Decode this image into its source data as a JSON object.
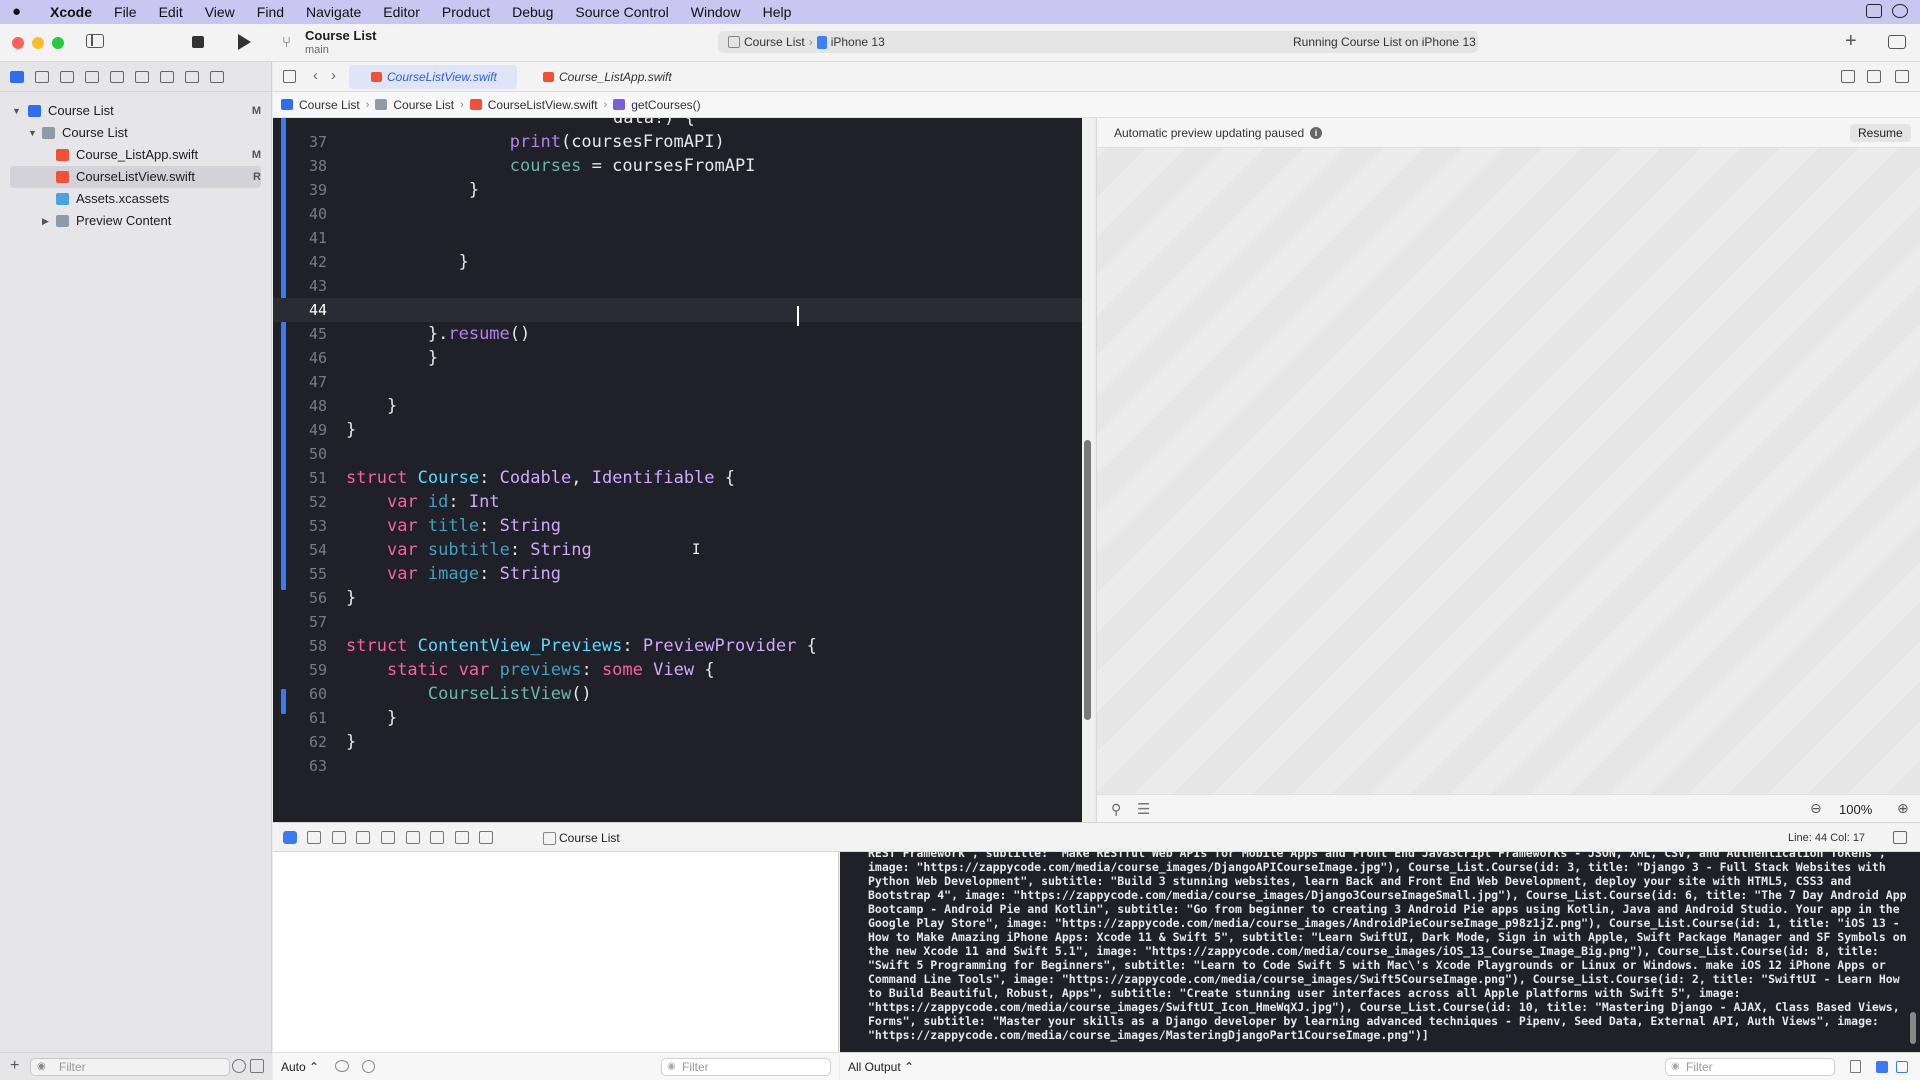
{
  "menubar": {
    "app": "Xcode",
    "items": [
      "File",
      "Edit",
      "View",
      "Find",
      "Navigate",
      "Editor",
      "Product",
      "Debug",
      "Source Control",
      "Window",
      "Help"
    ]
  },
  "toolbar": {
    "project_title": "Course List",
    "branch": "main",
    "scheme": "Course List",
    "device": "iPhone 13",
    "status": "Running Course List on iPhone 13"
  },
  "navigator": {
    "items": [
      {
        "label": "Course List",
        "badge": "M"
      },
      {
        "label": "Course List",
        "badge": ""
      },
      {
        "label": "Course_ListApp.swift",
        "badge": "M"
      },
      {
        "label": "CourseListView.swift",
        "badge": "R"
      },
      {
        "label": "Assets.xcassets",
        "badge": ""
      },
      {
        "label": "Preview Content",
        "badge": ""
      }
    ],
    "filter_placeholder": "Filter"
  },
  "tabs": {
    "active": "CourseListView.swift",
    "other": "Course_ListApp.swift"
  },
  "jumpbar": {
    "items": [
      "Course List",
      "Course List",
      "CourseListView.swift",
      "getCourses()"
    ]
  },
  "editor": {
    "first_line_text": "data!) {",
    "line_numbers": [
      "37",
      "38",
      "39",
      "40",
      "41",
      "42",
      "43",
      "44",
      "45",
      "46",
      "47",
      "48",
      "49",
      "50",
      "51",
      "52",
      "53",
      "54",
      "55",
      "56",
      "57",
      "58",
      "59",
      "60",
      "61",
      "62",
      "63"
    ]
  },
  "preview": {
    "message": "Automatic preview updating paused",
    "resume_label": "Resume",
    "zoom": "100%"
  },
  "debug": {
    "target": "Course List",
    "line_col": "Line: 44  Col: 17"
  },
  "variables": {
    "scope": "Auto ⌃",
    "filter_placeholder": "Filter"
  },
  "console": {
    "output_label": "All Output ⌃",
    "filter_placeholder": "Filter",
    "text": "REST Framework\", subtitle: \"Make RESTful Web APIs for Mobile Apps and Front End JavaScript Frameworks - JSON, XML, CSV, and Authentication Tokens\",\nimage: \"https://zappycode.com/media/course_images/DjangoAPICourseImage.jpg\"), Course_List.Course(id: 3, title: \"Django 3 - Full Stack Websites with\nPython Web Development\", subtitle: \"Build 3 stunning websites, learn Back and Front End Web Development, deploy your site with HTML5, CSS3 and\nBootstrap 4\", image: \"https://zappycode.com/media/course_images/Django3CourseImageSmall.jpg\"), Course_List.Course(id: 6, title: \"The 7 Day Android App\nBootcamp - Android Pie and Kotlin\", subtitle: \"Go from beginner to creating 3 Android Pie apps using Kotlin, Java and Android Studio. Your app in the\nGoogle Play Store\", image: \"https://zappycode.com/media/course_images/AndroidPieCourseImage_p98z1jZ.png\"), Course_List.Course(id: 1, title: \"iOS 13 -\nHow to Make Amazing iPhone Apps: Xcode 11 & Swift 5\", subtitle: \"Learn SwiftUI, Dark Mode, Sign in with Apple, Swift Package Manager and SF Symbols on\nthe new Xcode 11 and Swift 5.1\", image: \"https://zappycode.com/media/course_images/iOS_13_Course_Image_Big.png\"), Course_List.Course(id: 8, title:\n\"Swift 5 Programming for Beginners\", subtitle: \"Learn to Code Swift 5 with Mac\\'s Xcode Playgrounds or Linux or Windows. make iOS 12 iPhone Apps or\nCommand Line Tools\", image: \"https://zappycode.com/media/course_images/Swift5CourseImage.png\"), Course_List.Course(id: 2, title: \"SwiftUI - Learn How\nto Build Beautiful, Robust, Apps\", subtitle: \"Create stunning user interfaces across all Apple platforms with Swift 5\", image:\n\"https://zappycode.com/media/course_images/SwiftUI_Icon_HmeWqXJ.jpg\"), Course_List.Course(id: 10, title: \"Mastering Django - AJAX, Class Based Views,\nForms\", subtitle: \"Master your skills as a Django developer by learning advanced techniques - Pipenv, Seed Data, External API, Auth Views\", image:\n\"https://zappycode.com/media/course_images/MasteringDjangoPart1CourseImage.png\")]"
  },
  "colors": {
    "accent": "#3a7bf2",
    "editor_bg": "#1f2028",
    "keyword": "#fc5fa3",
    "type": "#5dd8ff"
  }
}
